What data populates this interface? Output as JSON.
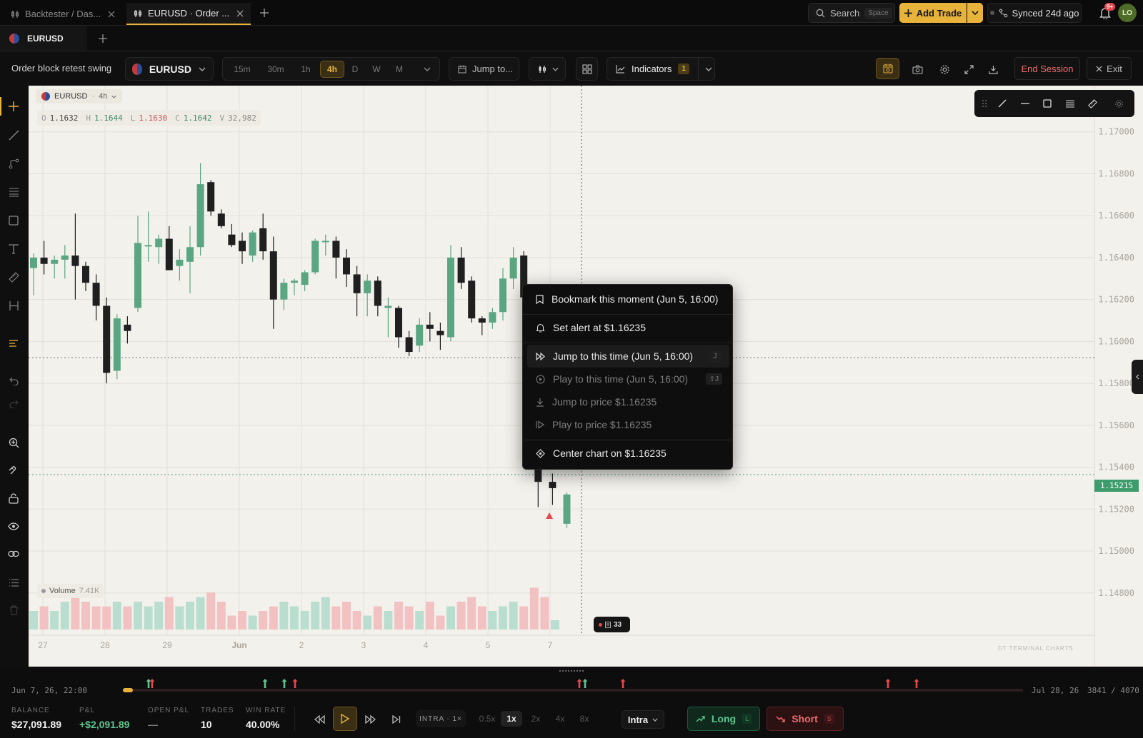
{
  "tabs": [
    {
      "label": "Backtester / Das...",
      "active": false
    },
    {
      "label": "EURUSD · Order ...",
      "active": true
    }
  ],
  "header": {
    "search_label": "Search",
    "search_hint": "Space",
    "add_trade_label": "Add Trade",
    "sync_label": "Synced 24d ago",
    "notif_badge": "9+",
    "avatar_initials": "LO"
  },
  "symbol_tab": {
    "label": "EURUSD"
  },
  "toolbar": {
    "session_name": "Order block retest swing",
    "symbol": "EURUSD",
    "timeframes": [
      "15m",
      "30m",
      "1h",
      "4h",
      "D",
      "W",
      "M"
    ],
    "active_timeframe": "4h",
    "jump_label": "Jump to...",
    "indicators_label": "Indicators",
    "indicators_count": "1",
    "end_session_label": "End Session",
    "exit_label": "Exit"
  },
  "chart": {
    "legend_symbol": "EURUSD",
    "legend_tf": "4h",
    "ohlc": {
      "o_label": "O",
      "o": "1.1632",
      "h_label": "H",
      "h": "1.1644",
      "l_label": "L",
      "l": "1.1630",
      "c_label": "C",
      "c": "1.1642",
      "v_label": "V",
      "v": "32,982"
    },
    "volume_label": "Volume",
    "volume_value": "7.41K",
    "current_price_tag": "1.15215",
    "watermark": "DT TERMINAL CHARTS",
    "event_badge": "33",
    "colors": {
      "up": "#5aa683",
      "down": "#1f1f1f",
      "bg": "#f3f1ec",
      "price_tag": "#3e9b6b",
      "accent": "#e8b33a"
    }
  },
  "chart_data": {
    "type": "candlestick",
    "y_ticks": [
      "1.17000",
      "1.16800",
      "1.16600",
      "1.16400",
      "1.16200",
      "1.16000",
      "1.15800",
      "1.15600",
      "1.15400",
      "1.15200",
      "1.15000",
      "1.14800"
    ],
    "x_ticks": [
      "27",
      "28",
      "29",
      "Jun",
      "2",
      "3",
      "4",
      "5",
      "7"
    ],
    "ylim": [
      1.1468,
      1.172
    ],
    "candles": [
      [
        1.1635,
        1.1642,
        1.1622,
        1.164
      ],
      [
        1.164,
        1.1648,
        1.1632,
        1.1637
      ],
      [
        1.1637,
        1.1641,
        1.163,
        1.1639
      ],
      [
        1.1639,
        1.1646,
        1.163,
        1.1641
      ],
      [
        1.1641,
        1.1661,
        1.162,
        1.1636
      ],
      [
        1.1636,
        1.1638,
        1.1624,
        1.1628
      ],
      [
        1.1628,
        1.1632,
        1.161,
        1.1617
      ],
      [
        1.1617,
        1.1621,
        1.158,
        1.1585
      ],
      [
        1.1586,
        1.1613,
        1.1582,
        1.1611
      ],
      [
        1.1608,
        1.1612,
        1.1599,
        1.1605
      ],
      [
        1.1616,
        1.166,
        1.1614,
        1.1647
      ],
      [
        1.1646,
        1.1662,
        1.1638,
        1.1646
      ],
      [
        1.1645,
        1.1651,
        1.1637,
        1.1649
      ],
      [
        1.1649,
        1.1655,
        1.1634,
        1.1634
      ],
      [
        1.1636,
        1.1644,
        1.1629,
        1.1639
      ],
      [
        1.1638,
        1.1655,
        1.1623,
        1.1645
      ],
      [
        1.1645,
        1.1685,
        1.1641,
        1.1675
      ],
      [
        1.1676,
        1.1677,
        1.166,
        1.1662
      ],
      [
        1.1661,
        1.1663,
        1.1654,
        1.1655
      ],
      [
        1.1651,
        1.1656,
        1.1645,
        1.1646
      ],
      [
        1.1648,
        1.1652,
        1.1637,
        1.1643
      ],
      [
        1.1641,
        1.1653,
        1.1638,
        1.1652
      ],
      [
        1.1654,
        1.1661,
        1.1639,
        1.1643
      ],
      [
        1.1643,
        1.165,
        1.1606,
        1.162
      ],
      [
        1.162,
        1.163,
        1.1615,
        1.1628
      ],
      [
        1.1628,
        1.163,
        1.1622,
        1.1629
      ],
      [
        1.1627,
        1.1634,
        1.1624,
        1.1633
      ],
      [
        1.1633,
        1.1649,
        1.1632,
        1.1648
      ],
      [
        1.1648,
        1.1651,
        1.1641,
        1.1648
      ],
      [
        1.1648,
        1.165,
        1.163,
        1.164
      ],
      [
        1.164,
        1.1644,
        1.1626,
        1.1632
      ],
      [
        1.1632,
        1.1636,
        1.1612,
        1.1623
      ],
      [
        1.1623,
        1.1632,
        1.1612,
        1.1629
      ],
      [
        1.1629,
        1.1631,
        1.1612,
        1.1617
      ],
      [
        1.1616,
        1.1621,
        1.1602,
        1.1617
      ],
      [
        1.1616,
        1.1617,
        1.1597,
        1.1602
      ],
      [
        1.1602,
        1.1605,
        1.1593,
        1.1595
      ],
      [
        1.1598,
        1.1611,
        1.1595,
        1.1608
      ],
      [
        1.1608,
        1.1614,
        1.16,
        1.1606
      ],
      [
        1.1605,
        1.1609,
        1.1596,
        1.1603
      ],
      [
        1.1602,
        1.1646,
        1.16,
        1.164
      ],
      [
        1.164,
        1.1645,
        1.1625,
        1.1628
      ],
      [
        1.1629,
        1.1631,
        1.1609,
        1.1611
      ],
      [
        1.1611,
        1.1612,
        1.1603,
        1.1609
      ],
      [
        1.1609,
        1.1616,
        1.1606,
        1.1614
      ],
      [
        1.1614,
        1.1635,
        1.161,
        1.163
      ],
      [
        1.163,
        1.1645,
        1.1625,
        1.164
      ],
      [
        1.1641,
        1.1643,
        1.162,
        1.1621
      ],
      [
        1.1545,
        1.1547,
        1.1521,
        1.1533
      ],
      [
        1.1533,
        1.1537,
        1.1522,
        1.153
      ],
      [
        1.1513,
        1.1528,
        1.1511,
        1.1527
      ]
    ],
    "volume": [
      4,
      5,
      4,
      6,
      9,
      6,
      5,
      5,
      6,
      5,
      6,
      5,
      6,
      7,
      5,
      6,
      7,
      8,
      6,
      3,
      4,
      3,
      4,
      5,
      6,
      5,
      4,
      6,
      7,
      5,
      6,
      4,
      3,
      5,
      4,
      6,
      5,
      4,
      6,
      3,
      5,
      6,
      7,
      5,
      4,
      5,
      6,
      5,
      9,
      7,
      2
    ]
  },
  "menu": {
    "items": [
      {
        "label": "Bookmark this moment (Jun 5, 16:00)",
        "dim": false,
        "shortcut": ""
      },
      {
        "label": "Set alert at $1.16235",
        "dim": false,
        "shortcut": ""
      },
      {
        "label": "Jump to this time (Jun 5, 16:00)",
        "dim": false,
        "shortcut": "J"
      },
      {
        "label": "Play to this time (Jun 5, 16:00)",
        "dim": true,
        "shortcut": "⇧J"
      },
      {
        "label": "Jump to price $1.16235",
        "dim": true,
        "shortcut": ""
      },
      {
        "label": "Play to price $1.16235",
        "dim": true,
        "shortcut": ""
      },
      {
        "label": "Center chart on $1.16235",
        "dim": false,
        "shortcut": ""
      }
    ]
  },
  "timeline": {
    "start_label": "Jun 7, 26, 22:00",
    "end_label": "Jul 28, 26",
    "counter": "3841 / 4070"
  },
  "footer": {
    "balance_label": "BALANCE",
    "balance": "$27,091.89",
    "pnl_label": "P&L",
    "pnl": "+$2,091.89",
    "open_pnl_label": "OPEN P&L",
    "open_pnl": "—",
    "trades_label": "TRADES",
    "trades": "10",
    "winrate_label": "WIN RATE",
    "winrate": "40.00%",
    "mode_label": "INTRA · 1×",
    "speeds": [
      "0.5x",
      "1x",
      "2x",
      "4x",
      "8x"
    ],
    "active_speed": "1x",
    "intra_select": "Intra",
    "long_label": "Long",
    "long_key": "L",
    "short_label": "Short",
    "short_key": "S"
  }
}
